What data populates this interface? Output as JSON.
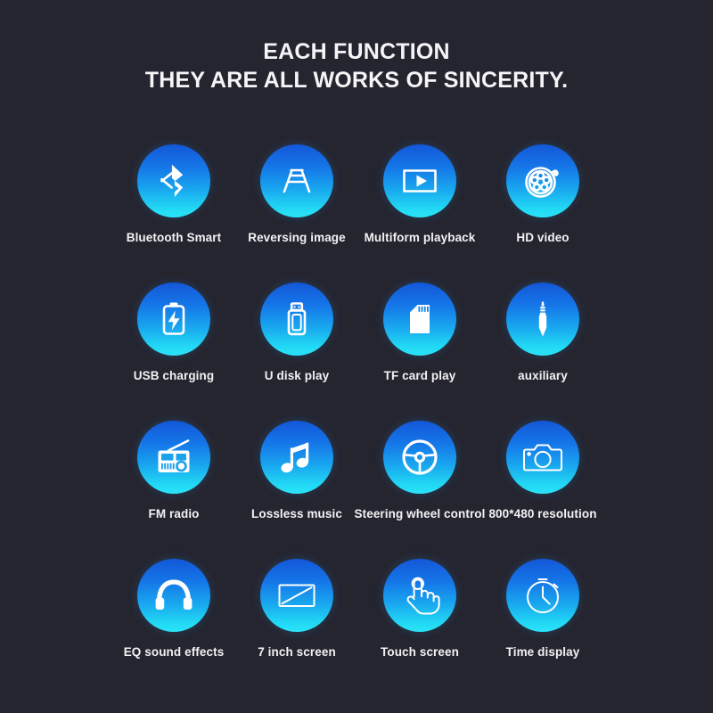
{
  "headline": {
    "line1": "EACH FUNCTION",
    "line2": "THEY ARE ALL WORKS OF SINCERITY."
  },
  "theme": {
    "background": "#252530",
    "text": "#f2f2f4",
    "badge_gradient_top": "#1357d8",
    "badge_gradient_bottom": "#2ae3f7"
  },
  "features": [
    {
      "icon": "bluetooth-icon",
      "label": "Bluetooth Smart"
    },
    {
      "icon": "reversing-image-icon",
      "label": "Reversing image"
    },
    {
      "icon": "video-playback-icon",
      "label": "Multiform playback"
    },
    {
      "icon": "film-reel-icon",
      "label": "HD video"
    },
    {
      "icon": "battery-charging-icon",
      "label": "USB charging"
    },
    {
      "icon": "usb-drive-icon",
      "label": "U disk play"
    },
    {
      "icon": "sd-card-icon",
      "label": "TF card play"
    },
    {
      "icon": "audio-jack-icon",
      "label": "auxiliary"
    },
    {
      "icon": "radio-icon",
      "label": "FM radio"
    },
    {
      "icon": "music-note-icon",
      "label": "Lossless music"
    },
    {
      "icon": "steering-wheel-icon",
      "label": "Steering wheel control"
    },
    {
      "icon": "camera-icon",
      "label": "800*480 resolution"
    },
    {
      "icon": "headphones-icon",
      "label": "EQ sound effects"
    },
    {
      "icon": "screen-diagonal-icon",
      "label": "7 inch screen"
    },
    {
      "icon": "touch-hand-icon",
      "label": "Touch screen"
    },
    {
      "icon": "stopwatch-icon",
      "label": "Time display"
    }
  ]
}
